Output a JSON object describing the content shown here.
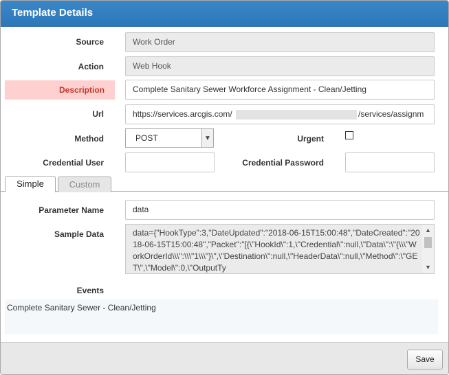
{
  "header": {
    "title": "Template Details"
  },
  "form": {
    "source": {
      "label": "Source",
      "value": "Work Order"
    },
    "action": {
      "label": "Action",
      "value": "Web Hook"
    },
    "description": {
      "label": "Description",
      "value": "Complete Sanitary Sewer Workforce Assignment - Clean/Jetting"
    },
    "url": {
      "label": "Url",
      "value_start": "https://services.arcgis.com/",
      "value_end": "/services/assignm"
    },
    "method": {
      "label": "Method",
      "value": "POST"
    },
    "urgent": {
      "label": "Urgent",
      "checked": false
    },
    "credential_user": {
      "label": "Credential User",
      "value": ""
    },
    "credential_password": {
      "label": "Credential Password",
      "value": ""
    }
  },
  "tabs": [
    {
      "label": "Simple",
      "active": true
    },
    {
      "label": "Custom",
      "active": false
    }
  ],
  "simple": {
    "parameter_name": {
      "label": "Parameter Name",
      "value": "data"
    },
    "sample_data": {
      "label": "Sample Data",
      "value": "data={\"HookType\":3,\"DateUpdated\":\"2018-06-15T15:00:48\",\"DateCreated\":\"2018-06-15T15:00:48\",\"Packet\":\"[{\\\"HookId\\\":1,\\\"Credential\\\":null,\\\"Data\\\":\\\"{\\\\\\\"WorkOrderId\\\\\\\":\\\\\\\"1\\\\\\\"}\\\",\\\"Destination\\\":null,\\\"HeaderData\\\":null,\\\"Method\\\":\\\"GET\\\",\\\"Model\\\":0,\\\"OutputTy"
    },
    "events": {
      "label": "Events",
      "items": [
        "Complete Sanitary Sewer - Clean/Jetting"
      ]
    }
  },
  "footer": {
    "save_label": "Save"
  }
}
